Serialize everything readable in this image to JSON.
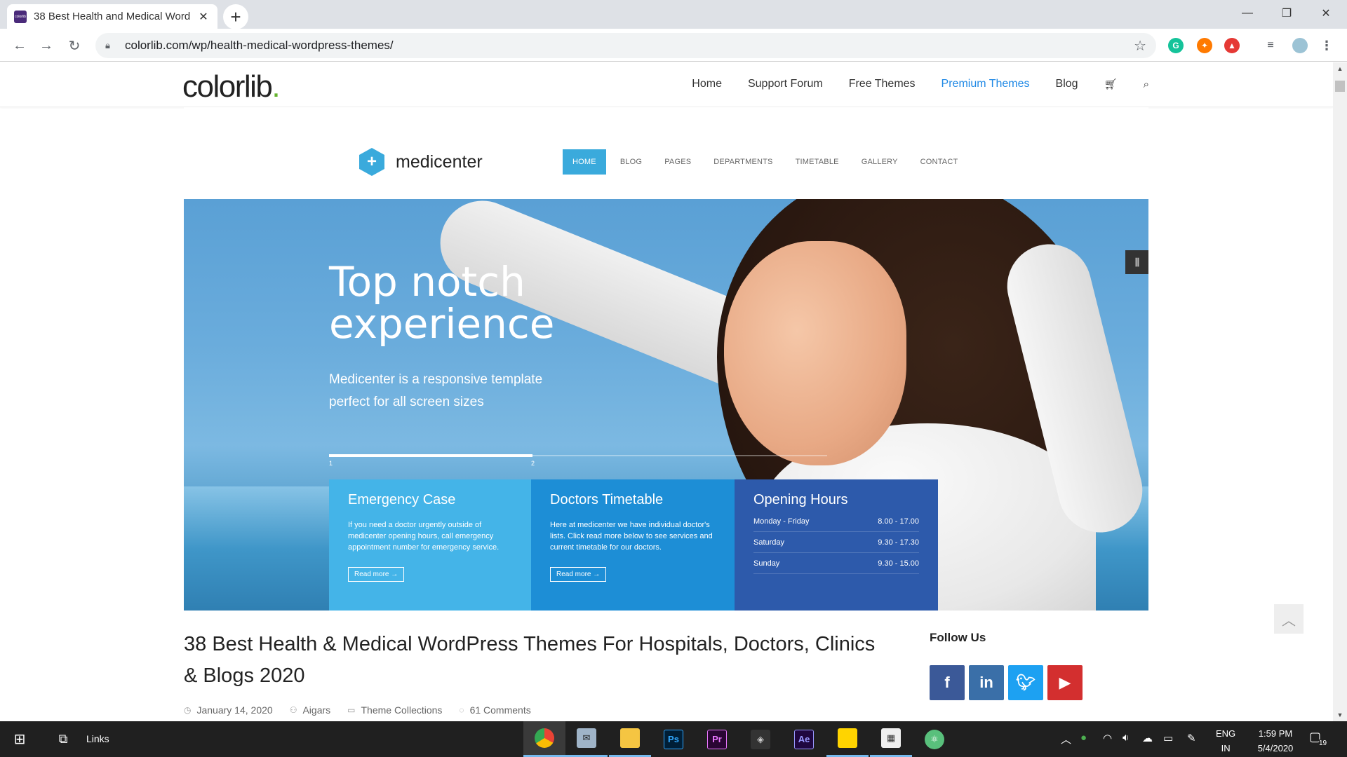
{
  "browser": {
    "tab_title": "38 Best Health and Medical Word",
    "favicon_text": "colorlib",
    "url": "colorlib.com/wp/health-medical-wordpress-themes/",
    "extensions": [
      "grammarly-icon",
      "fire-icon",
      "flask-icon",
      "media-icon",
      "profile-avatar"
    ]
  },
  "site": {
    "logo_main": "colorlib",
    "logo_dot": ".",
    "nav": [
      "Home",
      "Support Forum",
      "Free Themes",
      "Premium Themes",
      "Blog"
    ],
    "active_nav": "Premium Themes"
  },
  "hero": {
    "brand": "medicenter",
    "nav": [
      "HOME",
      "BLOG",
      "PAGES",
      "DEPARTMENTS",
      "TIMETABLE",
      "GALLERY",
      "CONTACT"
    ],
    "headline_1": "Top notch",
    "headline_2": "experience",
    "subtitle": "Medicenter is a responsive template perfect for all screen sizes",
    "slide_1": "1",
    "slide_2": "2",
    "boxes": [
      {
        "title": "Emergency Case",
        "body": "If you need a doctor urgently outside of medicenter opening hours, call emergency appointment number for emergency service.",
        "cta": "Read more →"
      },
      {
        "title": "Doctors Timetable",
        "body": "Here at medicenter we have individual doctor's lists. Click read more below to see services and current timetable for our doctors.",
        "cta": "Read more →"
      },
      {
        "title": "Opening Hours",
        "rows": [
          {
            "day": "Monday - Friday",
            "time": "8.00 - 17.00"
          },
          {
            "day": "Saturday",
            "time": "9.30 - 17.30"
          },
          {
            "day": "Sunday",
            "time": "9.30 - 15.00"
          }
        ]
      }
    ]
  },
  "post": {
    "title": "38 Best Health & Medical WordPress Themes For Hospitals, Doctors, Clinics & Blogs 2020",
    "date": "January 14, 2020",
    "author": "Aigars",
    "category": "Theme Collections",
    "comments": "61 Comments"
  },
  "sidebar": {
    "follow_title": "Follow Us",
    "social": [
      {
        "name": "facebook",
        "glyph": "f",
        "color": "#3b5998"
      },
      {
        "name": "linkedin",
        "glyph": "in",
        "color": "#3a6fa8"
      },
      {
        "name": "twitter",
        "glyph": "t",
        "color": "#1da1f2"
      },
      {
        "name": "youtube",
        "glyph": "▶",
        "color": "#d32f2f"
      }
    ]
  },
  "taskbar": {
    "links_label": "Links",
    "lang_1": "ENG",
    "lang_2": "IN",
    "time": "1:59 PM",
    "date": "5/4/2020",
    "notif_count": "19",
    "apps": [
      {
        "name": "chrome",
        "label": "",
        "color": "#4caf50"
      },
      {
        "name": "mail",
        "label": "",
        "color": "#9fb4c8"
      },
      {
        "name": "file-explorer",
        "label": "",
        "color": "#f5c542"
      },
      {
        "name": "photoshop",
        "label": "Ps",
        "color": "#31a8ff"
      },
      {
        "name": "premiere",
        "label": "Pr",
        "color": "#ea77ff"
      },
      {
        "name": "unity",
        "label": "",
        "color": "#ccc"
      },
      {
        "name": "after-effects",
        "label": "Ae",
        "color": "#9999ff"
      },
      {
        "name": "sticky-notes",
        "label": "",
        "color": "#ffd400"
      },
      {
        "name": "calculator",
        "label": "",
        "color": "#eee"
      },
      {
        "name": "atom",
        "label": "",
        "color": "#59c07c"
      }
    ]
  }
}
